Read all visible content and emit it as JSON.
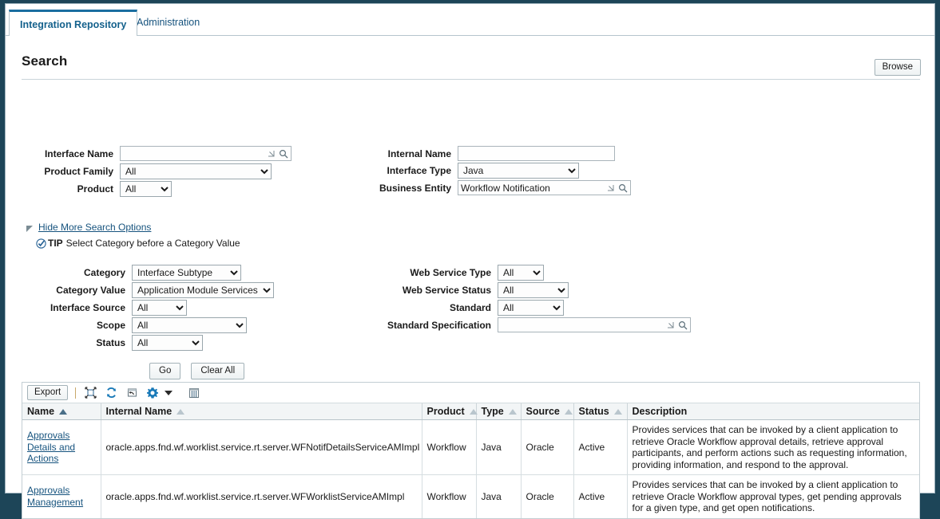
{
  "tabs": [
    {
      "label": "Integration Repository",
      "active": true
    },
    {
      "label": "Administration",
      "active": false
    }
  ],
  "header": {
    "title": "Search",
    "browse_label": "Browse"
  },
  "search_form": {
    "left": {
      "interface_name": {
        "label": "Interface Name",
        "value": "",
        "lov_icon": "lov-arrow-icon",
        "search_icon": "search-icon"
      },
      "product_family": {
        "label": "Product Family",
        "value": "All"
      },
      "product": {
        "label": "Product",
        "value": "All"
      }
    },
    "right": {
      "internal_name": {
        "label": "Internal Name",
        "value": ""
      },
      "interface_type": {
        "label": "Interface Type",
        "value": "Java"
      },
      "business_entity": {
        "label": "Business Entity",
        "value": "Workflow Notification",
        "lov_icon": "lov-arrow-icon",
        "search_icon": "search-icon"
      }
    }
  },
  "more_options": {
    "toggle_label": "Hide More Search Options",
    "disclosure_icon": "disclosure-triangle-icon",
    "tip_icon": "tip-check-icon",
    "tip_word": "TIP",
    "tip_text": "Select Category before a Category Value"
  },
  "advanced": {
    "left": {
      "category": {
        "label": "Category",
        "value": "Interface Subtype"
      },
      "category_value": {
        "label": "Category Value",
        "value": "Application Module Services"
      },
      "interface_source": {
        "label": "Interface Source",
        "value": "All"
      },
      "scope": {
        "label": "Scope",
        "value": "All"
      },
      "status": {
        "label": "Status",
        "value": "All"
      }
    },
    "right": {
      "web_service_type": {
        "label": "Web Service Type",
        "value": "All"
      },
      "web_service_status": {
        "label": "Web Service Status",
        "value": "All"
      },
      "standard": {
        "label": "Standard",
        "value": "All"
      },
      "standard_specification": {
        "label": "Standard Specification",
        "value": "",
        "lov_icon": "lov-arrow-icon",
        "search_icon": "search-icon"
      }
    }
  },
  "actions": {
    "go_label": "Go",
    "clear_all_label": "Clear All"
  },
  "results": {
    "toolbar": {
      "export_label": "Export",
      "icons": [
        {
          "name": "expand-all-icon"
        },
        {
          "name": "refresh-icon"
        },
        {
          "name": "detach-icon"
        },
        {
          "name": "gear-icon"
        },
        {
          "name": "chevron-down-icon"
        },
        {
          "name": "columns-icon"
        }
      ]
    },
    "columns": [
      {
        "label": "Name",
        "sort": "asc-active"
      },
      {
        "label": "Internal Name",
        "sort": "sortable"
      },
      {
        "label": "Product",
        "sort": "sortable"
      },
      {
        "label": "Type",
        "sort": "sortable"
      },
      {
        "label": "Source",
        "sort": "sortable"
      },
      {
        "label": "Status",
        "sort": "sortable"
      },
      {
        "label": "Description",
        "sort": "none"
      }
    ],
    "rows": [
      {
        "name": "Approvals Details and Actions",
        "internal_name": "oracle.apps.fnd.wf.worklist.service.rt.server.WFNotifDetailsServiceAMImpl",
        "product": "Workflow",
        "type": "Java",
        "source": "Oracle",
        "status": "Active",
        "description": "Provides services that can be invoked by a client application to retrieve Oracle Workflow approval details, retrieve approval participants, and perform actions such as requesting information, providing information, and respond to the approval."
      },
      {
        "name": "Approvals Management",
        "internal_name": "oracle.apps.fnd.wf.worklist.service.rt.server.WFWorklistServiceAMImpl",
        "product": "Workflow",
        "type": "Java",
        "source": "Oracle",
        "status": "Active",
        "description": "Provides services that can be invoked by a client application to retrieve Oracle Workflow approval types, get pending approvals for a given type, and get open notifications."
      }
    ]
  },
  "colors": {
    "frame": "#1d4558",
    "link": "#16537e",
    "active_tab": "#14618c",
    "header_bg": "#f2f5f6"
  }
}
